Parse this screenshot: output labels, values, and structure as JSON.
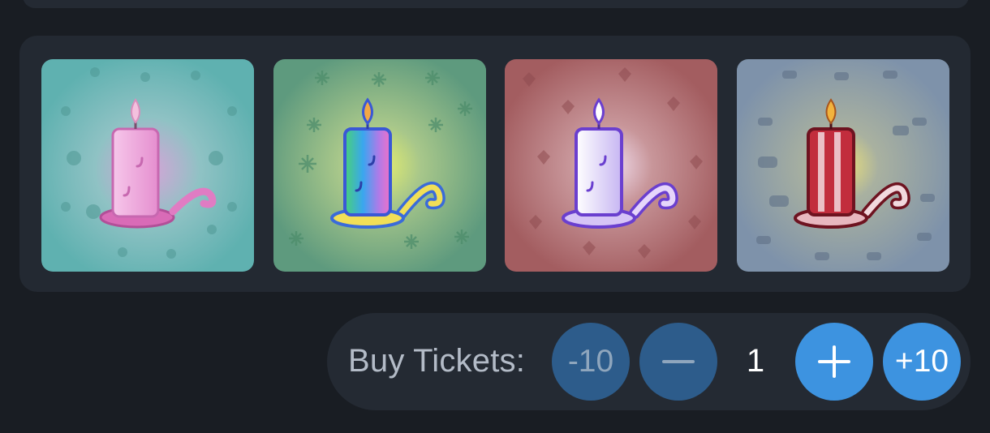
{
  "prizes": [
    {
      "name": "pink-candle",
      "background": "#63b3b1",
      "pattern": "ghost",
      "candle": "#f2a6d6",
      "glow": "#e9a7e0"
    },
    {
      "name": "rainbow-candle",
      "background": "#5f9a7e",
      "pattern": "snowflake",
      "candle": "#3ea3f2",
      "glow": "#e8ef6a"
    },
    {
      "name": "lavender-candle",
      "background": "#a35f62",
      "pattern": "leaf",
      "candle": "#d9cdf6",
      "glow": "#f1ddef"
    },
    {
      "name": "red-striped-candle",
      "background": "#7f93ab",
      "pattern": "goat",
      "candle": "#c22d3d",
      "glow": "#e6e07a"
    }
  ],
  "buy": {
    "label": "Buy Tickets:",
    "minus_ten": "-10",
    "quantity": "1",
    "plus_ten": "+10"
  },
  "colors": {
    "page_bg": "#191d23",
    "card_bg": "#232932",
    "button_dim": "#2d5c8b",
    "button_bright": "#3d93e0"
  }
}
